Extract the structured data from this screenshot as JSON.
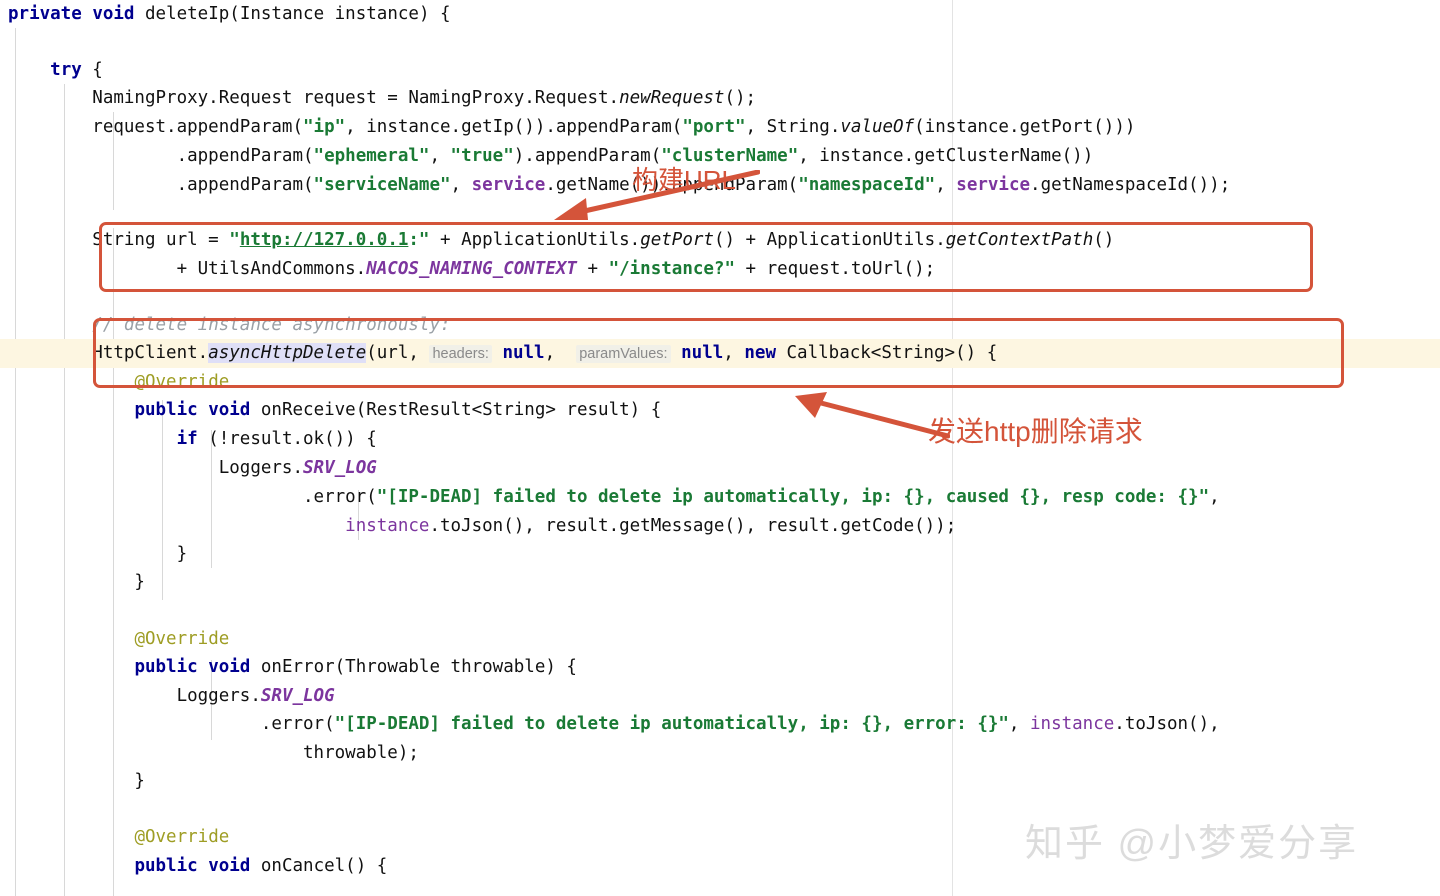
{
  "editor": {
    "language": "java",
    "font_size_px": 17.5,
    "line_height_px": 29,
    "background": "#ffffff",
    "highlighted_line_background": "#fdf6e1",
    "indent_guide_color": "#d8d8d8",
    "colors": {
      "keyword": "#00008f",
      "string": "#1a7a35",
      "comment": "#9aa0a6",
      "annotation": "#9e9d24",
      "static_field": "#7c359e",
      "default_text": "#111111",
      "parameter_hint_bg": "#f1f0e8",
      "parameter_hint_text": "#8a8a8a",
      "selection": "#dfdff7",
      "callout_red": "#d4543a"
    },
    "lines": [
      {
        "n": 1,
        "text": "private void deleteIp(Instance instance) {"
      },
      {
        "n": 2,
        "text": ""
      },
      {
        "n": 3,
        "text": "    try {"
      },
      {
        "n": 4,
        "text": "        NamingProxy.Request request = NamingProxy.Request.newRequest();"
      },
      {
        "n": 5,
        "text": "        request.appendParam(\"ip\", instance.getIp()).appendParam(\"port\", String.valueOf(instance.getPort()))"
      },
      {
        "n": 6,
        "text": "                .appendParam(\"ephemeral\", \"true\").appendParam(\"clusterName\", instance.getClusterName())"
      },
      {
        "n": 7,
        "text": "                .appendParam(\"serviceName\", service.getName()).appendParam(\"namespaceId\", service.getNamespaceId());"
      },
      {
        "n": 8,
        "text": ""
      },
      {
        "n": 9,
        "text": "        String url = \"http://127.0.0.1:\" + ApplicationUtils.getPort() + ApplicationUtils.getContextPath()"
      },
      {
        "n": 10,
        "text": "                + UtilsAndCommons.NACOS_NAMING_CONTEXT + \"/instance?\" + request.toUrl();"
      },
      {
        "n": 11,
        "text": ""
      },
      {
        "n": 12,
        "text": "        // delete instance asynchronously:"
      },
      {
        "n": 13,
        "text": "        HttpClient.asyncHttpDelete(url, headers: null, paramValues: null, new Callback<String>() {"
      },
      {
        "n": 14,
        "text": "            @Override"
      },
      {
        "n": 15,
        "text": "            public void onReceive(RestResult<String> result) {"
      },
      {
        "n": 16,
        "text": "                if (!result.ok()) {"
      },
      {
        "n": 17,
        "text": "                    Loggers.SRV_LOG"
      },
      {
        "n": 18,
        "text": "                            .error(\"[IP-DEAD] failed to delete ip automatically, ip: {}, caused {}, resp code: {}\","
      },
      {
        "n": 19,
        "text": "                                instance.toJson(), result.getMessage(), result.getCode());"
      },
      {
        "n": 20,
        "text": "                }"
      },
      {
        "n": 21,
        "text": "            }"
      },
      {
        "n": 22,
        "text": ""
      },
      {
        "n": 23,
        "text": "            @Override"
      },
      {
        "n": 24,
        "text": "            public void onError(Throwable throwable) {"
      },
      {
        "n": 25,
        "text": "                Loggers.SRV_LOG"
      },
      {
        "n": 26,
        "text": "                        .error(\"[IP-DEAD] failed to delete ip automatically, ip: {}, error: {}\", instance.toJson(),"
      },
      {
        "n": 27,
        "text": "                            throwable);"
      },
      {
        "n": 28,
        "text": "            }"
      },
      {
        "n": 29,
        "text": ""
      },
      {
        "n": 30,
        "text": "            @Override"
      },
      {
        "n": 31,
        "text": "            public void onCancel() {"
      }
    ],
    "parameter_hints": [
      {
        "label": "headers:",
        "value": "null"
      },
      {
        "label": "paramValues:",
        "value": "null"
      }
    ],
    "highlighted_line_number": 13
  },
  "annotations": [
    {
      "id": "build-url",
      "text": "构建URL",
      "font_size_px": 26,
      "color": "#d4543a",
      "target": "String url = \"http://127.0.0.1:\" ...",
      "arrow_direction": "down-left"
    },
    {
      "id": "send-http-delete",
      "text": "发送http删除请求",
      "font_size_px": 28,
      "color": "#d4543a",
      "target": "HttpClient.asyncHttpDelete(...)",
      "arrow_direction": "up-left"
    }
  ],
  "callout_boxes": [
    {
      "id": "url-build-box",
      "label": "构建URL 区域"
    },
    {
      "id": "http-delete-box",
      "label": "发送http删除请求 区域"
    }
  ],
  "watermark": {
    "text": "知乎 @小梦爱分享",
    "color": "#dcdcdc"
  }
}
